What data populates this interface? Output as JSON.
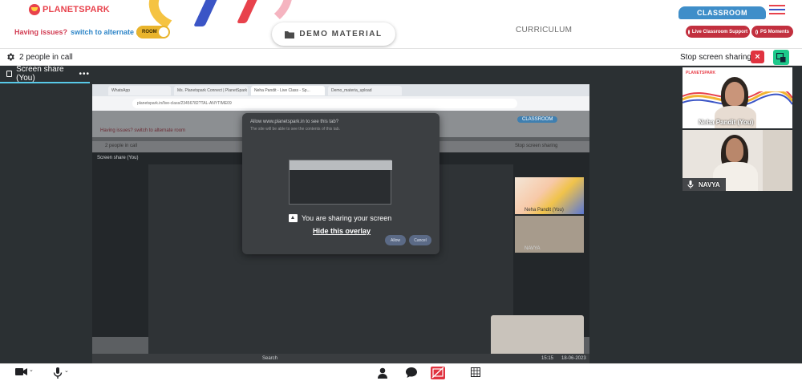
{
  "header": {
    "logo_text": "PLANETSPARK",
    "issues_question": "Having issues?",
    "issues_link": "switch to alternate room",
    "room_toggle_label": "ROOM",
    "demo_material_label": "DEMO MATERIAL",
    "curriculum_label": "CURRICULUM",
    "classroom_label": "CLASSROOM",
    "live_support_label": "Live Classroom Support",
    "ps_moments_label": "PS Moments"
  },
  "call_bar": {
    "people_count": "2 people in call",
    "stop_sharing_label": "Stop screen sharing",
    "stop_icon": "×"
  },
  "share_tab": {
    "label": "Screen share (You)",
    "more": "•••"
  },
  "shared_screen": {
    "browser_tabs": [
      "WhatsApp",
      "Ms. Planetspark Connect | PlanetSpark",
      "Neha Pandit - Live Class - Sp...",
      "Demo_materia_upload"
    ],
    "url": "planetspark.in/live-class/23456782?TAL-ANYTIME09",
    "inner_people": "2 people in call",
    "inner_stop": "Stop screen sharing",
    "inner_share_tab": "Screen share (You)",
    "inner_issues": "Having issues? switch to alternate room",
    "inner_classroom": "CLASSROOM",
    "inner_name1": "Neha Pandit (You)",
    "inner_name2": "NAVYA",
    "taskbar_search": "Search",
    "taskbar_lang": "ENG\nUS",
    "taskbar_time": "15:15",
    "taskbar_date": "18-06-2023",
    "dialog_title": "Allow www.planetspark.in to see this tab?",
    "dialog_sub": "The site will be able to see the contents of this tab.",
    "sharing_text": "You are sharing your screen",
    "hide_overlay": "Hide this overlay",
    "allow_label": "Allow",
    "cancel_label": "Cancel"
  },
  "participants": [
    {
      "name": "Neha Pandit (You)",
      "mini_logo": "PLANETSPARK"
    },
    {
      "name": "NAVYA"
    }
  ],
  "colors": {
    "brand_red": "#e8424c",
    "brand_blue": "#3f8ec9",
    "stop_red": "#e03340",
    "pip_green": "#1ec98b",
    "share_accent": "#58c9e8"
  }
}
